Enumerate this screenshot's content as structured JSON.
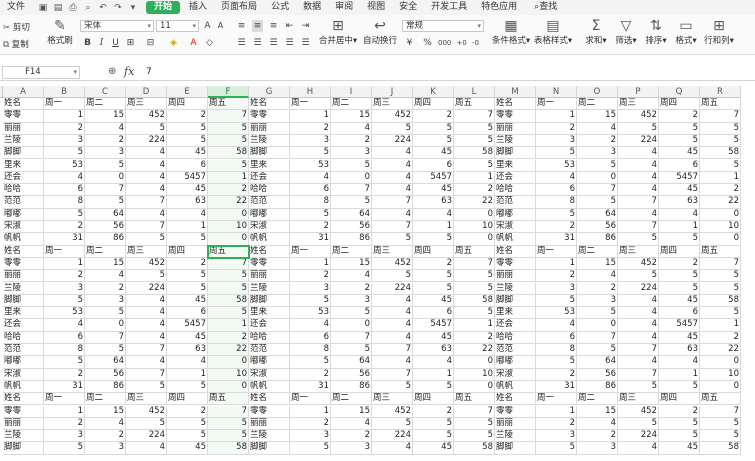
{
  "menubar": {
    "file": "文件",
    "items": [
      "开始",
      "插入",
      "页面布局",
      "公式",
      "数据",
      "审阅",
      "视图",
      "安全",
      "开发工具",
      "特色应用"
    ],
    "active": "开始",
    "search": "查找"
  },
  "ribbon": {
    "cut": "剪切",
    "copy": "复制",
    "format_painter": "格式刷",
    "font_name": "宋体",
    "font_size": "11",
    "merge_center": "合并居中",
    "wrap_text": "自动换行",
    "number_format": "常规",
    "conditional_format": "条件格式",
    "table_style": "表格样式",
    "sum": "求和",
    "filter": "筛选",
    "sort": "排序",
    "format": "格式",
    "rows_cols": "行和列"
  },
  "formula_bar": {
    "name_box": "F14",
    "fx": "fx",
    "value": "7"
  },
  "sheet": {
    "columns": [
      "A",
      "B",
      "C",
      "D",
      "E",
      "F",
      "G",
      "H",
      "I",
      "J",
      "K",
      "L",
      "M",
      "N",
      "O",
      "P",
      "Q",
      "R"
    ],
    "selected_column": "F",
    "active_cell": {
      "row": 13,
      "col": 5
    },
    "header_row": [
      "姓名",
      "周一",
      "周二",
      "周三",
      "周四",
      "周五",
      "姓名",
      "周一",
      "周二",
      "周三",
      "周四",
      "周五",
      "姓名",
      "周一",
      "周二",
      "周三",
      "周四",
      "周五"
    ],
    "data_rows": [
      [
        "零零",
        "1",
        "15",
        "452",
        "2",
        "7",
        "零零",
        "1",
        "15",
        "452",
        "2",
        "7",
        "零零",
        "1",
        "15",
        "452",
        "2",
        "7"
      ],
      [
        "丽丽",
        "2",
        "4",
        "5",
        "5",
        "5",
        "丽丽",
        "2",
        "4",
        "5",
        "5",
        "5",
        "丽丽",
        "2",
        "4",
        "5",
        "5",
        "5"
      ],
      [
        "兰陵",
        "3",
        "2",
        "224",
        "5",
        "5",
        "兰陵",
        "3",
        "2",
        "224",
        "5",
        "5",
        "兰陵",
        "3",
        "2",
        "224",
        "5",
        "5"
      ],
      [
        "脚脚",
        "5",
        "3",
        "4",
        "45",
        "58",
        "脚脚",
        "5",
        "3",
        "4",
        "45",
        "58",
        "脚脚",
        "5",
        "3",
        "4",
        "45",
        "58"
      ],
      [
        "里来",
        "53",
        "5",
        "4",
        "6",
        "5",
        "里来",
        "53",
        "5",
        "4",
        "6",
        "5",
        "里来",
        "53",
        "5",
        "4",
        "6",
        "5"
      ],
      [
        "还会",
        "4",
        "0",
        "4",
        "5457",
        "1",
        "还会",
        "4",
        "0",
        "4",
        "5457",
        "1",
        "还会",
        "4",
        "0",
        "4",
        "5457",
        "1"
      ],
      [
        "哈哈",
        "6",
        "7",
        "4",
        "45",
        "2",
        "哈哈",
        "6",
        "7",
        "4",
        "45",
        "2",
        "哈哈",
        "6",
        "7",
        "4",
        "45",
        "2"
      ],
      [
        "范范",
        "8",
        "5",
        "7",
        "63",
        "22",
        "范范",
        "8",
        "5",
        "7",
        "63",
        "22",
        "范范",
        "8",
        "5",
        "7",
        "63",
        "22"
      ],
      [
        "嘟嘟",
        "5",
        "64",
        "4",
        "4",
        "0",
        "嘟嘟",
        "5",
        "64",
        "4",
        "4",
        "0",
        "嘟嘟",
        "5",
        "64",
        "4",
        "4",
        "0"
      ],
      [
        "宋淑",
        "2",
        "56",
        "7",
        "1",
        "10",
        "宋淑",
        "2",
        "56",
        "7",
        "1",
        "10",
        "宋淑",
        "2",
        "56",
        "7",
        "1",
        "10"
      ],
      [
        "帆帆",
        "31",
        "86",
        "5",
        "5",
        "0",
        "帆帆",
        "31",
        "86",
        "5",
        "5",
        "0",
        "帆帆",
        "31",
        "86",
        "5",
        "5",
        "0"
      ]
    ],
    "first_row_number": 1,
    "visible_rows": 29
  }
}
